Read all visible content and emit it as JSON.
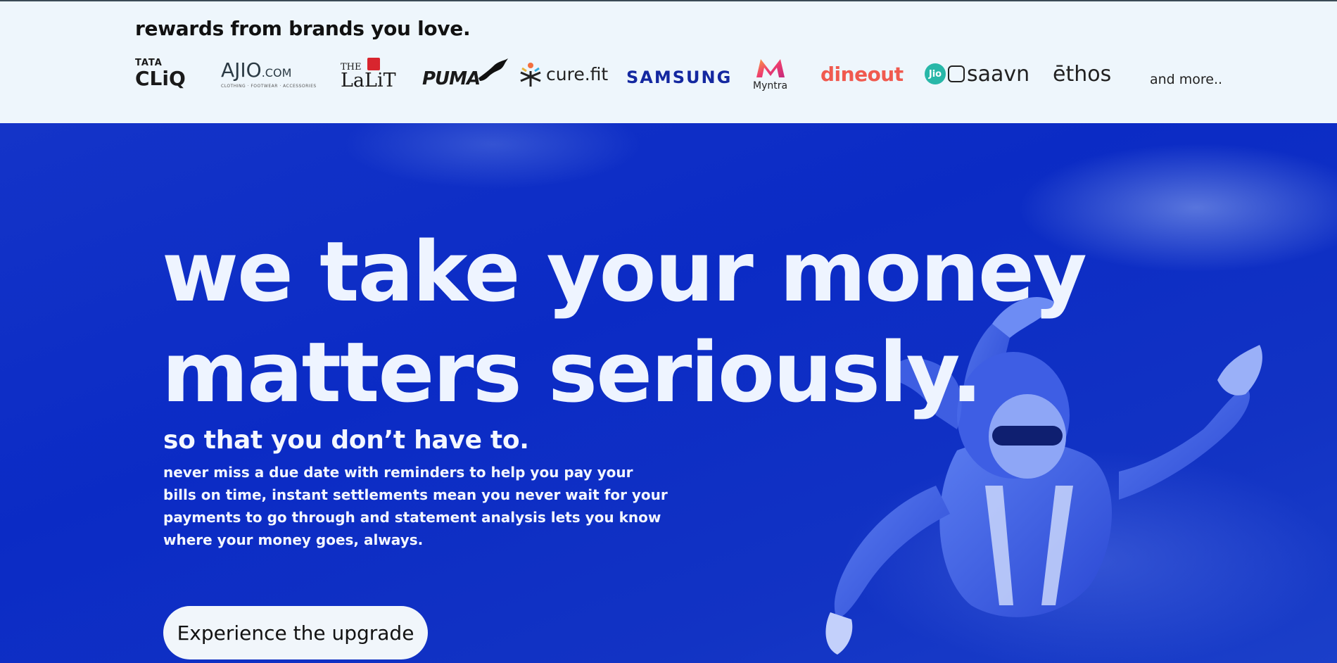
{
  "brands_section": {
    "title": "rewards from brands you love.",
    "logos": {
      "tatacliq": {
        "line1": "TATA",
        "line2": "CLiQ"
      },
      "ajio": {
        "name": "AJIO",
        "suffix": ".COM",
        "tagline": "CLOTHING · FOOTWEAR · ACCESSORIES"
      },
      "lalit": {
        "prefix": "THE",
        "name": "LaLiT"
      },
      "puma": {
        "name": "PUMA"
      },
      "curefit": {
        "name": "cure.fit"
      },
      "samsung": {
        "name": "SAMSUNG"
      },
      "myntra": {
        "name": "Myntra"
      },
      "dineout": {
        "name": "dineout"
      },
      "jiosaavn": {
        "badge": "Jio",
        "name": "saavn"
      },
      "ethos": {
        "name": "ēthos"
      }
    },
    "more_label": "and more.."
  },
  "hero": {
    "headline_line1": "we take your money",
    "headline_line2": "matters seriously.",
    "subheadline": "so that you don’t have to.",
    "description": "never miss a due date with reminders to help you pay your bills on time, instant settlements mean you never wait for your payments to go through and statement analysis lets you know where your money goes, always.",
    "cta_label": "Experience the upgrade"
  },
  "colors": {
    "hero_background": "#0b2bc5",
    "brand_strip_background": "#eef6fc",
    "samsung_blue": "#1428a0",
    "dineout_coral": "#f05a4f",
    "jio_teal": "#28b7a8"
  }
}
